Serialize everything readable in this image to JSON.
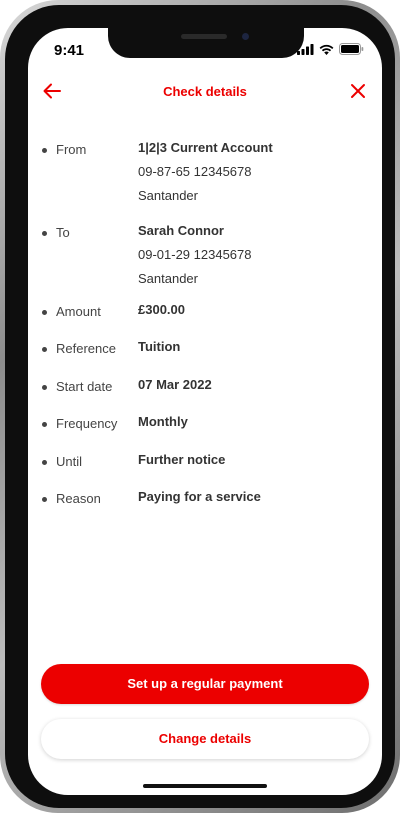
{
  "status_bar": {
    "time": "9:41"
  },
  "header": {
    "title": "Check details"
  },
  "details": [
    {
      "label": "From",
      "lines": [
        "1|2|3 Current Account",
        "09-87-65 12345678",
        "Santander"
      ]
    },
    {
      "label": "To",
      "lines": [
        "Sarah Connor",
        "09-01-29 12345678",
        "Santander"
      ]
    },
    {
      "label": "Amount",
      "lines": [
        "£300.00"
      ]
    },
    {
      "label": "Reference",
      "lines": [
        "Tuition"
      ]
    },
    {
      "label": "Start date",
      "lines": [
        "07 Mar 2022"
      ]
    },
    {
      "label": "Frequency",
      "lines": [
        "Monthly"
      ]
    },
    {
      "label": "Until",
      "lines": [
        "Further notice"
      ]
    },
    {
      "label": "Reason",
      "lines": [
        "Paying for a service"
      ]
    }
  ],
  "buttons": {
    "primary": "Set up a regular payment",
    "secondary": "Change details"
  },
  "colors": {
    "accent": "#ec0000",
    "text": "#333333"
  }
}
